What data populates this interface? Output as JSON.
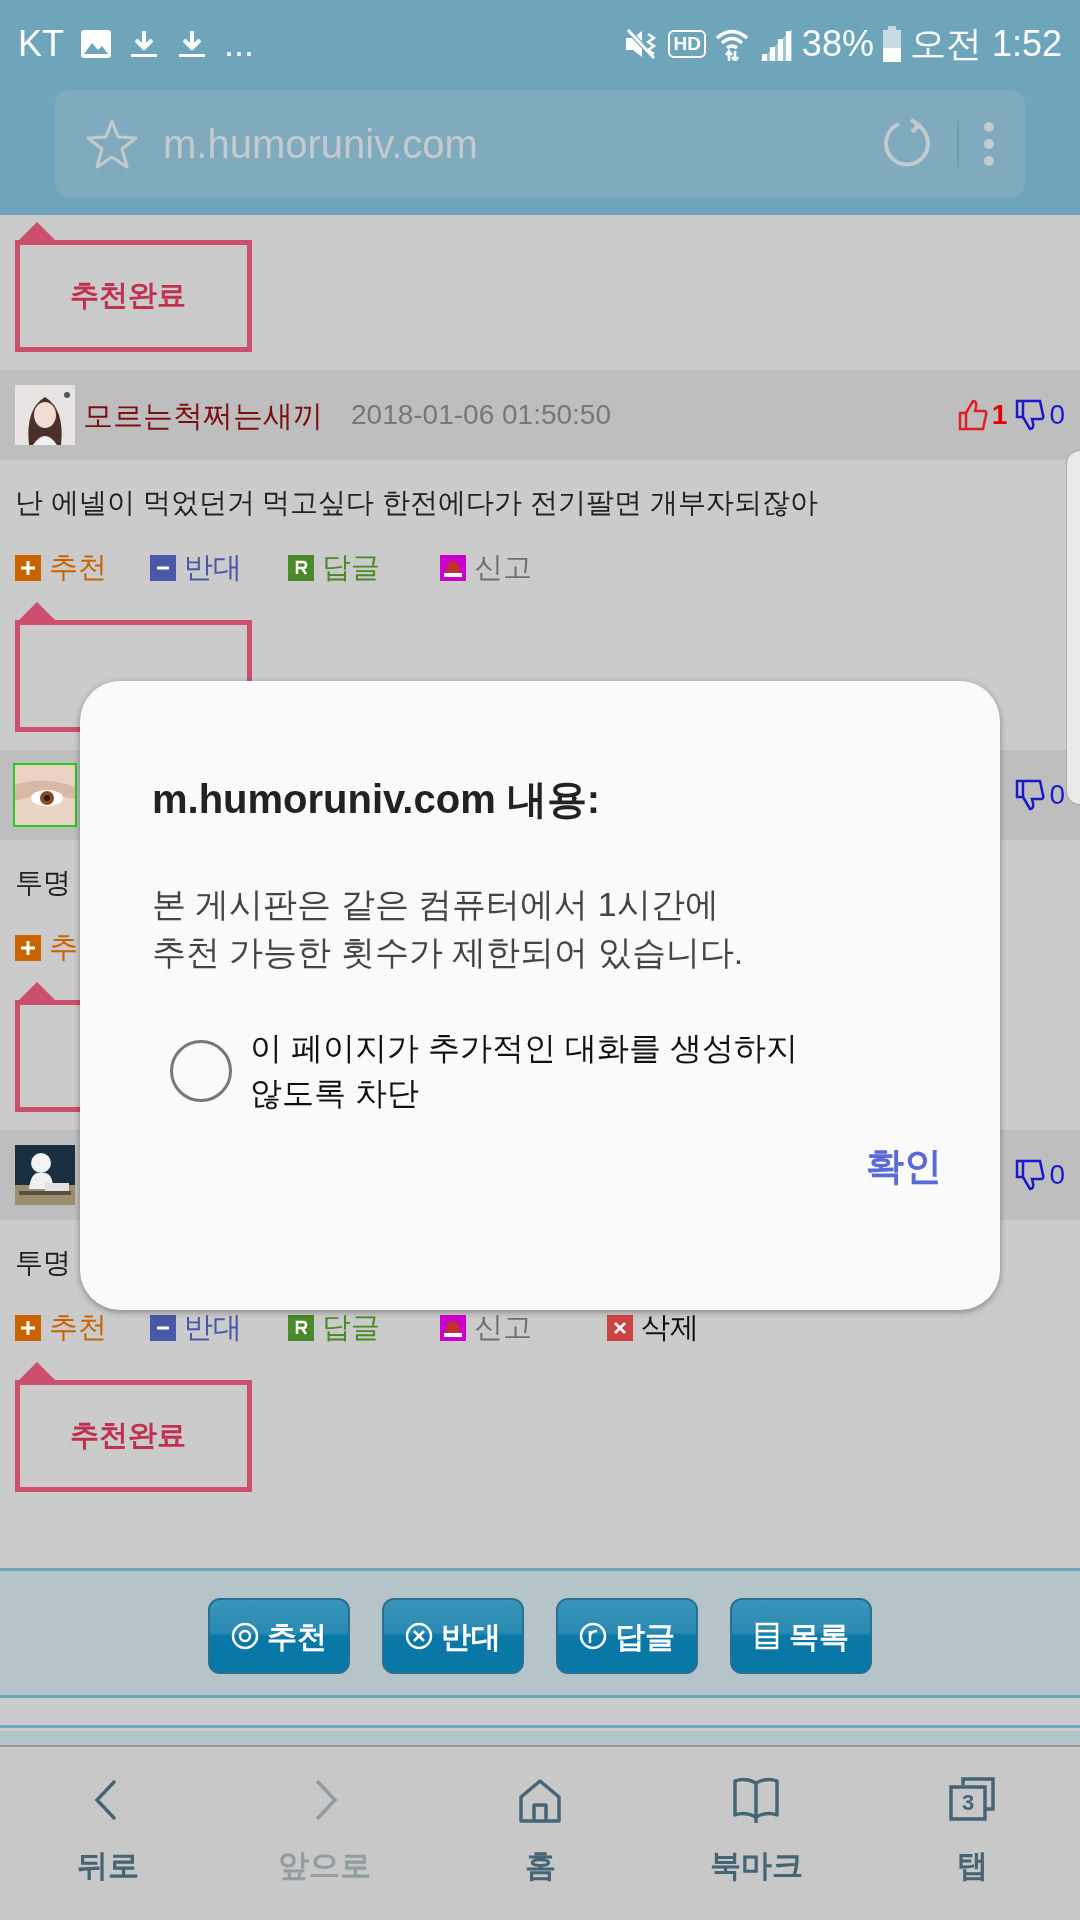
{
  "status_bar": {
    "carrier": "KT",
    "more": "...",
    "hd_label": "HD",
    "battery_text": "38%",
    "time": "오전 1:52"
  },
  "address_bar": {
    "url": "m.humoruniv.com"
  },
  "top_recommend": {
    "recommended": true,
    "badge": "추천완료"
  },
  "comments": [
    {
      "avatar": {
        "kind": "picture"
      },
      "avatar_highlight": false,
      "author": "모르는척쩌는새끼",
      "date": "2018-01-06 01:50:50",
      "likes": "1",
      "dislikes": "0",
      "text": "난 에넬이 먹었던거 먹고싶다 한전에다가 전기팔면 개부자되잖아",
      "actions": [
        {
          "kind": "up",
          "label": "추천"
        },
        {
          "kind": "down",
          "label": "반대"
        },
        {
          "kind": "reply",
          "label": "답글"
        },
        {
          "kind": "report",
          "label": "신고"
        }
      ],
      "recommended": true
    },
    {
      "avatar": {
        "kind": "picture"
      },
      "avatar_highlight": true,
      "dislikes": "0",
      "text": "투명",
      "actions": [
        {
          "kind": "up",
          "label": "추"
        }
      ],
      "recommended": true
    },
    {
      "avatar": {
        "kind": "picture"
      },
      "avatar_highlight": false,
      "dislikes": "0",
      "text": "투명",
      "actions": [
        {
          "kind": "up",
          "label": "추천"
        },
        {
          "kind": "down",
          "label": "반대"
        },
        {
          "kind": "reply",
          "label": "답글"
        },
        {
          "kind": "report",
          "label": "신고"
        },
        {
          "kind": "delete",
          "label": "삭제"
        }
      ],
      "recommended": true,
      "badge": "추천완료"
    }
  ],
  "bottom_buttons": [
    {
      "kind": "up",
      "label": "추천"
    },
    {
      "kind": "down",
      "label": "반대"
    },
    {
      "kind": "reply",
      "label": "답글"
    },
    {
      "kind": "list",
      "label": "목록"
    }
  ],
  "dialog": {
    "title": "m.humoruniv.com 내용:",
    "message": "본 게시판은 같은 컴퓨터에서 1시간에\n추천 가능한 횟수가 제한되어 있습니다.",
    "option_label": "이 페이지가 추가적인 대화를 생성하지\n않도록 차단",
    "checked": false,
    "ok_label": "확인"
  },
  "nav": [
    {
      "kind": "back",
      "label": "뒤로",
      "disabled": false
    },
    {
      "kind": "forward",
      "label": "앞으로",
      "disabled": true
    },
    {
      "kind": "home",
      "label": "홈",
      "disabled": false
    },
    {
      "kind": "bookmarks",
      "label": "북마크",
      "disabled": false
    },
    {
      "kind": "tabs",
      "label": "탭",
      "count": "3",
      "disabled": false
    }
  ]
}
